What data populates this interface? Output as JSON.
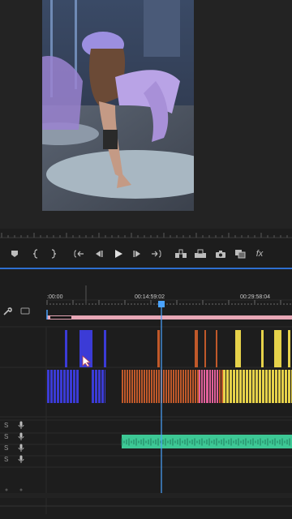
{
  "timecodes": {
    "start": ":00:00",
    "middle": "00:14:59:02",
    "end": "00:29:58:04"
  },
  "toolbar": {
    "marker_icon": "marker-icon",
    "mark_in_icon": "mark-in-icon",
    "mark_out_icon": "mark-out-icon",
    "goto_in_icon": "go-to-in-icon",
    "step_back_icon": "step-back-icon",
    "play_icon": "play-icon",
    "step_forward_icon": "step-forward-icon",
    "goto_out_icon": "go-to-out-icon",
    "insert_icon": "insert-icon",
    "overwrite_icon": "overwrite-icon",
    "export_frame_icon": "camera-icon",
    "compare_icon": "compare-icon",
    "fx_label": "fx"
  },
  "audio_tracks": [
    {
      "solo": "S"
    },
    {
      "solo": "S"
    },
    {
      "solo": "S"
    },
    {
      "solo": "S"
    }
  ],
  "colors": {
    "accent": "#2e6fd0",
    "playhead": "#4aa3ff",
    "clip_blue": "#3b3bd6",
    "clip_orange": "#c0592a",
    "clip_pink": "#e0609a",
    "clip_yellow": "#e6d24a",
    "clip_audio_green": "#3dc895",
    "workarea_pink": "#e7a7b6"
  }
}
